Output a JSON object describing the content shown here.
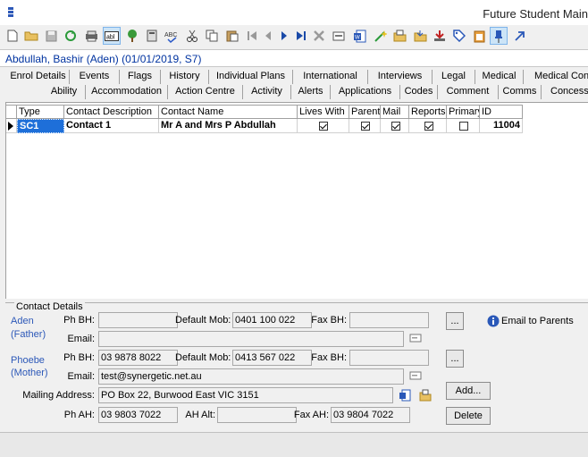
{
  "window": {
    "title": "Future Student Main"
  },
  "toolbar": {
    "icons": [
      "new-icon",
      "open-folder-icon",
      "save-icon",
      "refresh-icon",
      "print-icon",
      "text-field-icon",
      "tree-icon",
      "calculator-icon",
      "spellcheck-icon",
      "cut-icon",
      "copy-icon",
      "paste-icon",
      "first-record-icon",
      "previous-record-icon",
      "next-record-icon",
      "last-record-icon",
      "delete-icon",
      "form-icon",
      "word-doc-icon",
      "sparkle-arrow-icon",
      "print-folder-icon",
      "export-folder-icon",
      "download-icon",
      "tag-icon",
      "clipboard-icon",
      "pin-icon",
      "arrow-up-right-icon"
    ]
  },
  "student": {
    "header": "Abdullah, Bashir (Aden) (01/01/2019, S7)"
  },
  "tabs": {
    "row1": [
      "Enrol Details",
      "Events",
      "Flags",
      "History",
      "Individual Plans",
      "International",
      "Interviews",
      "Legal",
      "Medical",
      "Medical Condi"
    ],
    "row2": [
      "Ability",
      "Accommodation",
      "Action Centre",
      "Activity",
      "Alerts",
      "Applications",
      "Codes",
      "Comment",
      "Comms",
      "Concession"
    ]
  },
  "grid": {
    "columns": [
      "Type",
      "Contact Description",
      "Contact Name",
      "Lives With",
      "Parent",
      "Mail",
      "Reports",
      "Primary",
      "ID"
    ],
    "rows": [
      {
        "type": "SC1",
        "description": "Contact 1",
        "name": "Mr A and Mrs P Abdullah",
        "lives_with": true,
        "parent": true,
        "mail": true,
        "reports": true,
        "primary": false,
        "id": "11004"
      }
    ]
  },
  "contact_details": {
    "section_title": "Contact Details",
    "contact1": {
      "name": "Aden",
      "relation": "(Father)"
    },
    "contact2": {
      "name": "Phoebe",
      "relation": "(Mother)"
    },
    "labels": {
      "ph_bh": "Ph BH:",
      "default_mob": "Default Mob:",
      "fax_bh": "Fax BH:",
      "email": "Email:",
      "mailing_address": "Mailing Address:",
      "ph_ah": "Ph AH:",
      "ah_alt": "AH Alt:",
      "fax_ah": "Fax AH:"
    },
    "values": {
      "c1_ph_bh": "",
      "c1_default_mob": "0401 100 022",
      "c1_fax_bh": "",
      "c1_email": "",
      "c2_ph_bh": "03 9878 8022",
      "c2_default_mob": "0413 567 022",
      "c2_fax_bh": "",
      "c2_email": "test@synergetic.net.au",
      "mailing_address": "PO Box 22, Burwood East VIC 3151",
      "ph_ah": "03 9803 7022",
      "ah_alt": "",
      "fax_ah": "03 9804 7022"
    },
    "buttons": {
      "more1": "...",
      "more2": "...",
      "add": "Add...",
      "delete": "Delete"
    },
    "email_to_parents": "Email to Parents"
  }
}
